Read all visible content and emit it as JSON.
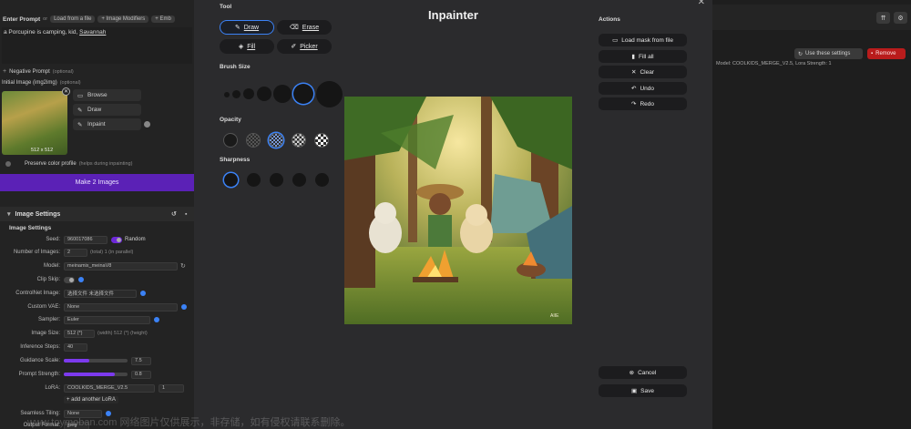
{
  "left": {
    "enter_prompt_label": "Enter Prompt",
    "or_label": "or",
    "load_from_file": "Load from a file",
    "image_modifiers": "+ Image Modifiers",
    "embeddings": "+ Emb",
    "prompt_text": "a Porcupine is camping, kid,",
    "prompt_link": "Savannah",
    "negative_prompt": "Negative Prompt",
    "optional": "(optional)",
    "initial_image": "Initial Image (img2img)",
    "initial_optional": "(optional)",
    "thumb_size": "512 x 512",
    "browse": "Browse",
    "draw": "Draw",
    "inpaint": "Inpaint",
    "preserve_color": "Preserve color profile",
    "preserve_hint": "(helps during inpainting)",
    "make_button": "Make 2 Images",
    "image_settings_header": "Image Settings",
    "image_settings_sub": "Image Settings",
    "rows": [
      {
        "k": "Seed:",
        "v": "960017086",
        "extra": "Random"
      },
      {
        "k": "Number of Images:",
        "v": "2",
        "extra": "(total)   1   (in parallel)"
      },
      {
        "k": "Model:",
        "v": "meinamix_meinaV8"
      },
      {
        "k": "Clip Skip:",
        "v": ""
      },
      {
        "k": "ControlNet Image:",
        "v": "选择文件  未选择文件"
      },
      {
        "k": "Custom VAE:",
        "v": "None"
      },
      {
        "k": "Sampler:",
        "v": "Euler"
      },
      {
        "k": "Image Size:",
        "v": "512 (*)",
        "extra": "(width)   512 (*)   (height)"
      },
      {
        "k": "Inference Steps:",
        "v": "40"
      },
      {
        "k": "Guidance Scale:",
        "v": "7.5"
      },
      {
        "k": "Prompt Strength:",
        "v": "0.8"
      },
      {
        "k": "LoRA:",
        "v": "COOLKIDS_MERGE_V2.5",
        "extra": "1"
      },
      {
        "k": "",
        "v": "+ add another LoRA"
      },
      {
        "k": "Seamless Tiling:",
        "v": "None"
      },
      {
        "k": "Output Format:",
        "v": "jpeg"
      }
    ]
  },
  "right": {
    "use_settings": "Use these settings",
    "remove": "Remove",
    "model_line": "Model: COOLKIDS_MERGE_V2.5,  Lora Strength: 1"
  },
  "dialog": {
    "title": "Inpainter",
    "tool_label": "Tool",
    "tools": [
      {
        "label": "Draw",
        "icon": "pencil-icon",
        "glyph": "✎",
        "active": true
      },
      {
        "label": "Erase",
        "icon": "eraser-icon",
        "glyph": "⌫",
        "active": false
      },
      {
        "label": "Fill",
        "icon": "paint-bucket-icon",
        "glyph": "◈",
        "active": false
      },
      {
        "label": "Picker",
        "icon": "eyedropper-icon",
        "glyph": "✐",
        "active": false
      }
    ],
    "brush_size_label": "Brush Size",
    "opacity_label": "Opacity",
    "sharpness_label": "Sharpness",
    "actions_label": "Actions",
    "actions": [
      {
        "label": "Load mask from file",
        "icon": "folder-icon",
        "glyph": "▭"
      },
      {
        "label": "Fill all",
        "icon": "paint-roller-icon",
        "glyph": "▮"
      },
      {
        "label": "Clear",
        "icon": "close-icon",
        "glyph": "✕"
      },
      {
        "label": "Undo",
        "icon": "undo-icon",
        "glyph": "↶"
      },
      {
        "label": "Redo",
        "icon": "redo-icon",
        "glyph": "↷"
      }
    ],
    "cancel": "Cancel",
    "save": "Save",
    "image_signature": "AIIE"
  },
  "watermark": "www.toymoban.com 网络图片仅供展示，非存储，如有侵权请联系删除。",
  "colors": {
    "accent_blue": "#3b82f6",
    "make_purple": "#5b21b6",
    "remove_red": "#b91c1c",
    "dialog_bg": "#2b2b2d"
  }
}
